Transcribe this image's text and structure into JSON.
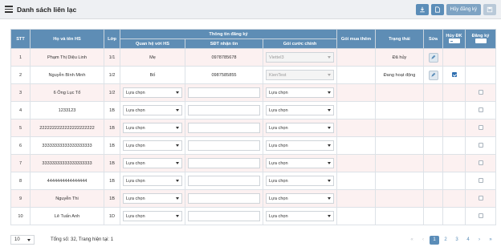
{
  "header": {
    "title": "Danh sách liên lạc",
    "cancel_label": "Hủy đăng ký"
  },
  "colors": {
    "header_bg": "#5e8db5",
    "accent": "#5b8db8",
    "row_pink": "#fcf1f1"
  },
  "columns": {
    "stt": "STT",
    "name": "Họ và tên HS",
    "class": "Lớp",
    "group": "Thông tin đăng ký",
    "relation": "Quan hệ với HS",
    "phone": "SĐT nhận tin",
    "package": "Gói cước chính",
    "extra": "Gói mua thêm",
    "status": "Trạng thái",
    "edit": "Sửa",
    "cancel": "Hủy ĐK",
    "register": "Đăng ký"
  },
  "rows": [
    {
      "stt": "1",
      "name": "Phạm Thị Diệu Linh",
      "class": "1/1",
      "relation": "Mẹ",
      "phone": "0978785678",
      "package": "Viettel3",
      "status": "Đã hủy"
    },
    {
      "stt": "2",
      "name": "Nguyễn Bình Minh",
      "class": "1/2",
      "relation": "Bố",
      "phone": "0987585855",
      "package": "KienTest",
      "status": "Đang hoạt động"
    },
    {
      "stt": "3",
      "name": "6 Ông Lục Tổ",
      "class": "1/2",
      "relation": "Lựa chọn",
      "phone": "",
      "package": "Lựa chọn",
      "status": ""
    },
    {
      "stt": "4",
      "name": "1233123",
      "class": "1B",
      "relation": "Lựa chọn",
      "phone": "",
      "package": "Lựa chọn",
      "status": ""
    },
    {
      "stt": "5",
      "name": "2222222222222222222222",
      "class": "1B",
      "relation": "Lựa chọn",
      "phone": "",
      "package": "Lựa chọn",
      "status": ""
    },
    {
      "stt": "6",
      "name": "33333333333333333333",
      "class": "1B",
      "relation": "Lựa chọn",
      "phone": "",
      "package": "Lựa chọn",
      "status": ""
    },
    {
      "stt": "7",
      "name": "33333333333333333333",
      "class": "1B",
      "relation": "Lựa chọn",
      "phone": "",
      "package": "Lựa chọn",
      "status": ""
    },
    {
      "stt": "8",
      "name": "4444444444444444",
      "class": "1B",
      "relation": "Lựa chọn",
      "phone": "",
      "package": "Lựa chọn",
      "status": ""
    },
    {
      "stt": "9",
      "name": "Nguyễn Thi",
      "class": "1B",
      "relation": "Lựa chọn",
      "phone": "",
      "package": "Lựa chọn",
      "status": ""
    },
    {
      "stt": "10",
      "name": "Lê Tuấn Anh",
      "class": "1D",
      "relation": "Lựa chọn",
      "phone": "",
      "package": "Lựa chọn",
      "status": ""
    }
  ],
  "footer": {
    "page_size": "10",
    "total": "Tổng số: 32, Trang hiện tại: 1",
    "pages": [
      "1",
      "2",
      "3",
      "4"
    ],
    "first": "«",
    "prev": "‹",
    "next": "›",
    "last": "»"
  }
}
